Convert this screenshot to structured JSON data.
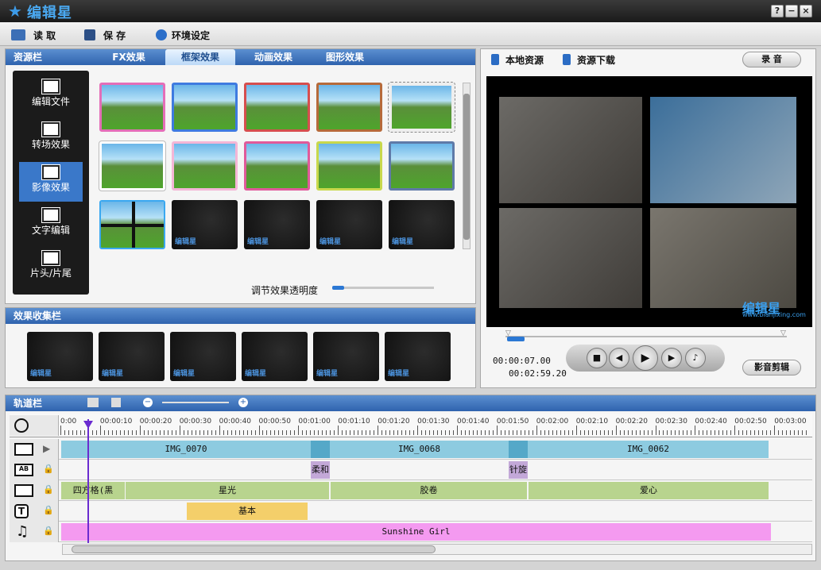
{
  "app": {
    "title": "编辑星"
  },
  "window": {
    "help": "?",
    "minimize": "−",
    "close": "×"
  },
  "toolbar": {
    "read": "读 取",
    "save": "保 存",
    "settings": "环境设定"
  },
  "resource": {
    "title": "资源栏",
    "tabs": [
      "FX效果",
      "框架效果",
      "动画效果",
      "图形效果"
    ],
    "active_tab": "框架效果",
    "side_items": [
      "编辑文件",
      "转场效果",
      "影像效果",
      "文字编辑",
      "片头/片尾"
    ],
    "opacity_label": "调节效果透明度",
    "opacity": 0.12
  },
  "collection": {
    "title": "效果收集栏"
  },
  "watermark": "编辑星",
  "watermark_url": "www.bianjixing.com",
  "right": {
    "local": "本地资源",
    "download": "资源下载",
    "record": "录 音",
    "edit": "影音剪辑"
  },
  "player": {
    "current": "00:00:07.00",
    "total": "00:02:59.20"
  },
  "timeline": {
    "title": "轨道栏",
    "ticks": [
      "0:00",
      "00:00:10",
      "00:00:20",
      "00:00:30",
      "00:00:40",
      "00:00:50",
      "00:01:00",
      "00:01:10",
      "00:01:20",
      "00:01:30",
      "00:01:40",
      "00:01:50",
      "00:02:00",
      "00:02:10",
      "00:02:20",
      "00:02:30",
      "00:02:40",
      "00:02:50",
      "00:03:00"
    ],
    "video_clips": [
      "IMG_0070",
      "IMG_0068",
      "IMG_0062"
    ],
    "transitions": [
      "柔和",
      "针旋"
    ],
    "effects": [
      "四方格(黑",
      "星光",
      "胶卷",
      "爱心"
    ],
    "text_clips": [
      "基本"
    ],
    "audio": "Sunshine Girl"
  }
}
